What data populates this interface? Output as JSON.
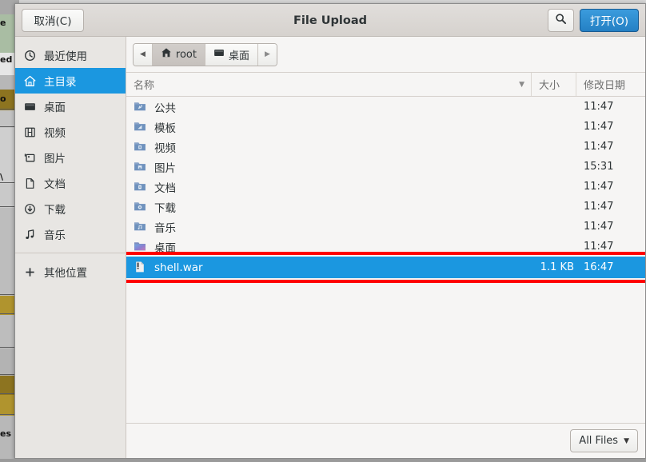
{
  "window": {
    "title": "File Upload",
    "cancel_label": "取消(C)",
    "open_label": "打开(O)",
    "search_icon": "search-icon"
  },
  "sidebar": {
    "items": [
      {
        "label": "最近使用",
        "icon": "clock-icon",
        "active": false
      },
      {
        "label": "主目录",
        "icon": "home-icon",
        "active": true
      },
      {
        "label": "桌面",
        "icon": "desktop-icon",
        "active": false
      },
      {
        "label": "视频",
        "icon": "film-icon",
        "active": false
      },
      {
        "label": "图片",
        "icon": "image-icon",
        "active": false
      },
      {
        "label": "文档",
        "icon": "document-icon",
        "active": false
      },
      {
        "label": "下载",
        "icon": "download-icon",
        "active": false
      },
      {
        "label": "音乐",
        "icon": "music-icon",
        "active": false
      }
    ],
    "other_locations": {
      "label": "其他位置",
      "icon": "plus-icon"
    }
  },
  "pathbar": {
    "back_arrow": "◀",
    "forward_arrow": "▶",
    "segments": [
      {
        "label": "root",
        "icon": "home-icon",
        "current": true
      },
      {
        "label": "桌面",
        "icon": "desktop-icon",
        "current": false
      }
    ]
  },
  "columns": {
    "name": "名称",
    "size": "大小",
    "modified": "修改日期",
    "sort_caret": "▼"
  },
  "files": [
    {
      "name": "公共",
      "size": "",
      "modified": "11:47",
      "icon": "folder-public-icon",
      "selected": false
    },
    {
      "name": "模板",
      "size": "",
      "modified": "11:47",
      "icon": "folder-templates-icon",
      "selected": false
    },
    {
      "name": "视频",
      "size": "",
      "modified": "11:47",
      "icon": "folder-videos-icon",
      "selected": false
    },
    {
      "name": "图片",
      "size": "",
      "modified": "15:31",
      "icon": "folder-pictures-icon",
      "selected": false
    },
    {
      "name": "文档",
      "size": "",
      "modified": "11:47",
      "icon": "folder-documents-icon",
      "selected": false
    },
    {
      "name": "下载",
      "size": "",
      "modified": "11:47",
      "icon": "folder-downloads-icon",
      "selected": false
    },
    {
      "name": "音乐",
      "size": "",
      "modified": "11:47",
      "icon": "folder-music-icon",
      "selected": false
    },
    {
      "name": "桌面",
      "size": "",
      "modified": "11:47",
      "icon": "folder-desktop-icon",
      "selected": false
    },
    {
      "name": "shell.war",
      "size": "1.1 KB",
      "modified": "16:47",
      "icon": "file-icon",
      "selected": true
    }
  ],
  "footer": {
    "filter_label": "All Files",
    "filter_caret": "▼"
  },
  "annotation": {
    "color": "#ff0000",
    "target": "shell.war"
  },
  "background": {
    "fragments": [
      "e",
      "ed",
      "o",
      "\\",
      "es"
    ]
  },
  "colors": {
    "accent": "#1b97e0",
    "open_button": "#2480c4",
    "annotation": "#ff0000",
    "chrome": "#f6f5f4",
    "sidebar": "#e8e6e3"
  }
}
